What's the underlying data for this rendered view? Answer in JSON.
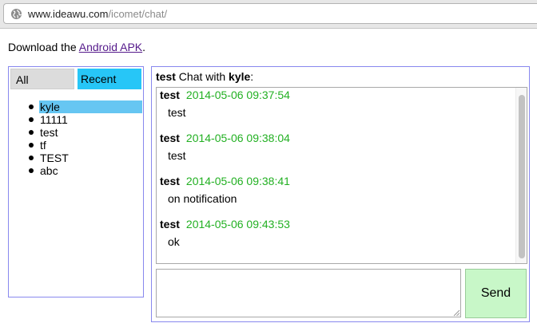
{
  "browser": {
    "url_host": "www.ideawu.com",
    "url_path": "/icomet/chat/"
  },
  "download": {
    "prefix": "Download the ",
    "link": "Android APK",
    "suffix": "."
  },
  "tabs": {
    "all": "All",
    "recent": "Recent"
  },
  "users": [
    "kyle",
    "11111",
    "test",
    "tf",
    "TEST",
    "abc"
  ],
  "selected_user": "kyle",
  "chat": {
    "me": "test",
    "with_label": " Chat with ",
    "partner": "kyle",
    "colon": ":"
  },
  "messages": [
    {
      "from": "test",
      "time": "2014-05-06 09:37:54",
      "text": "test"
    },
    {
      "from": "test",
      "time": "2014-05-06 09:38:04",
      "text": "test"
    },
    {
      "from": "test",
      "time": "2014-05-06 09:38:41",
      "text": "on notification"
    },
    {
      "from": "test",
      "time": "2014-05-06 09:43:53",
      "text": "ok"
    }
  ],
  "send_label": "Send",
  "colors": {
    "panel_border": "#8888ee",
    "recent_tab": "#27c6f7",
    "selected_user": "#66c6f2",
    "timestamp": "#22b022",
    "send_button": "#c8f7c8",
    "link": "#551a8b"
  },
  "icons": {
    "url_bar": "globe-icon",
    "compose": "resize-grip-icon"
  }
}
